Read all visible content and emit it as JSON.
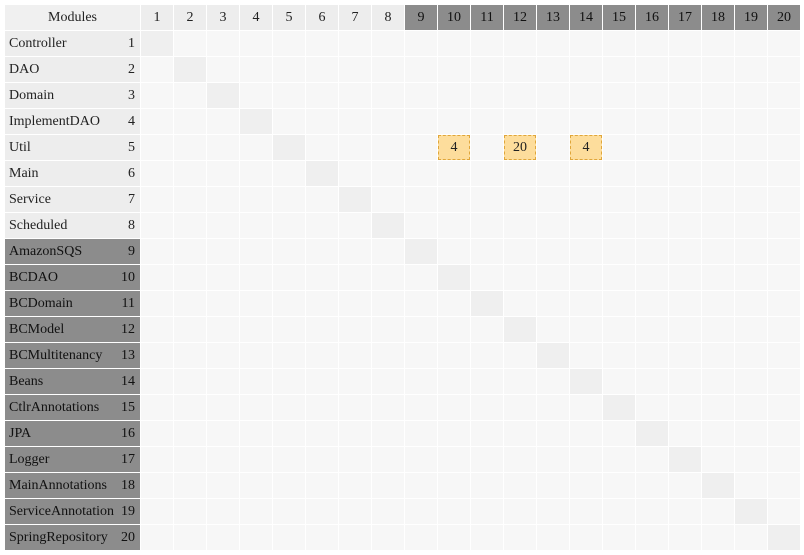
{
  "header": {
    "title": "Modules"
  },
  "colors": {
    "light_header": "#ededed",
    "dark_header": "#8c8c8c",
    "cell": "#f7f7f7",
    "diagonal": "#efefef",
    "dependency": "#fddd9c"
  },
  "modules": [
    {
      "name": "Controller",
      "index": "1",
      "group": "light"
    },
    {
      "name": "DAO",
      "index": "2",
      "group": "light"
    },
    {
      "name": "Domain",
      "index": "3",
      "group": "light"
    },
    {
      "name": "ImplementDAO",
      "index": "4",
      "group": "light"
    },
    {
      "name": "Util",
      "index": "5",
      "group": "light"
    },
    {
      "name": "Main",
      "index": "6",
      "group": "light"
    },
    {
      "name": "Service",
      "index": "7",
      "group": "light"
    },
    {
      "name": "Scheduled",
      "index": "8",
      "group": "light"
    },
    {
      "name": "AmazonSQS",
      "index": "9",
      "group": "dark"
    },
    {
      "name": "BCDAO",
      "index": "10",
      "group": "dark"
    },
    {
      "name": "BCDomain",
      "index": "11",
      "group": "dark"
    },
    {
      "name": "BCModel",
      "index": "12",
      "group": "dark"
    },
    {
      "name": "BCMultitenancy",
      "index": "13",
      "group": "dark"
    },
    {
      "name": "Beans",
      "index": "14",
      "group": "dark"
    },
    {
      "name": "CtlrAnnotations",
      "index": "15",
      "group": "dark"
    },
    {
      "name": "JPA",
      "index": "16",
      "group": "dark"
    },
    {
      "name": "Logger",
      "index": "17",
      "group": "dark"
    },
    {
      "name": "MainAnnotations",
      "index": "18",
      "group": "dark"
    },
    {
      "name": "ServiceAnnotation",
      "index": "19",
      "group": "dark"
    },
    {
      "name": "SpringRepository",
      "index": "20",
      "group": "dark"
    }
  ],
  "dependencies": [
    {
      "row": 5,
      "col": 10,
      "value": "4"
    },
    {
      "row": 5,
      "col": 12,
      "value": "20"
    },
    {
      "row": 5,
      "col": 14,
      "value": "4"
    }
  ]
}
